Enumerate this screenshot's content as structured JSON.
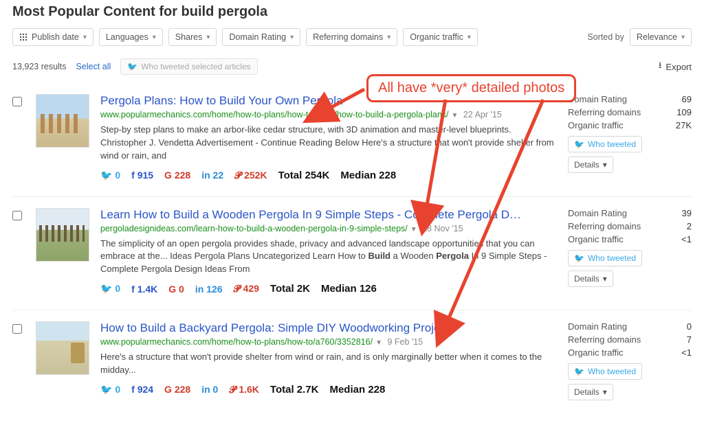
{
  "page_title": "Most Popular Content for build pergola",
  "filters": {
    "publish_date": "Publish date",
    "languages": "Languages",
    "shares": "Shares",
    "domain_rating": "Domain Rating",
    "referring_domains": "Referring domains",
    "organic_traffic": "Organic traffic"
  },
  "sorted_by_label": "Sorted by",
  "sorted_by_value": "Relevance",
  "results_count": "13,923 results",
  "select_all": "Select all",
  "who_tweeted_selected": "Who tweeted selected articles",
  "export": "Export",
  "labels": {
    "domain_rating": "Domain Rating",
    "referring_domains": "Referring domains",
    "organic_traffic": "Organic traffic",
    "who_tweeted": "Who tweeted",
    "details": "Details",
    "total": "Total",
    "median": "Median"
  },
  "annotation": "All have *very* detailed photos",
  "results": [
    {
      "title": "Pergola Plans: How to Build Your Own Pergola",
      "url": "www.popularmechanics.com/home/how-to-plans/how-to/a760/how-to-build-a-pergola-plans/",
      "date": "22 Apr '15",
      "snippet": "Step-by step plans to make an arbor-like cedar structure, with 3D animation and master-level blueprints. Christopher J. Vendetta Advertisement - Continue Reading Below Here's a structure that won't provide shelter from wind or rain, and",
      "shares": {
        "tw": "0",
        "fb": "915",
        "g": "228",
        "in": "22",
        "p": "252K"
      },
      "total": "254K",
      "median": "228",
      "domain_rating": "69",
      "referring_domains": "109",
      "organic_traffic": "27K"
    },
    {
      "title": "Learn How to Build a Wooden Pergola In 9 Simple Steps - Complete Pergola D…",
      "url": "pergoladesignideas.com/learn-how-to-build-a-wooden-pergola-in-9-simple-steps/",
      "date": "28 Nov '15",
      "snippet_pre": "The simplicity of an open pergola provides shade, privacy and advanced landscape opportunities that you can embrace at the... Ideas Pergola Plans Uncategorized Learn How to ",
      "snippet_b1": "Build",
      "snippet_mid": " a Wooden ",
      "snippet_b2": "Pergola",
      "snippet_post": " In 9 Simple Steps - Complete Pergola Design Ideas From",
      "shares": {
        "tw": "0",
        "fb": "1.4K",
        "g": "0",
        "in": "126",
        "p": "429"
      },
      "total": "2K",
      "median": "126",
      "domain_rating": "39",
      "referring_domains": "2",
      "organic_traffic": "<1"
    },
    {
      "title": "How to Build a Backyard Pergola: Simple DIY Woodworking Project",
      "url": "www.popularmechanics.com/home/how-to-plans/how-to/a760/3352816/",
      "date": "9 Feb '15",
      "snippet": "Here's a structure that won't provide shelter from wind or rain, and is only marginally better when it comes to the midday...",
      "shares": {
        "tw": "0",
        "fb": "924",
        "g": "228",
        "in": "0",
        "p": "1.6K"
      },
      "total": "2.7K",
      "median": "228",
      "domain_rating": "0",
      "referring_domains": "7",
      "organic_traffic": "<1"
    }
  ]
}
